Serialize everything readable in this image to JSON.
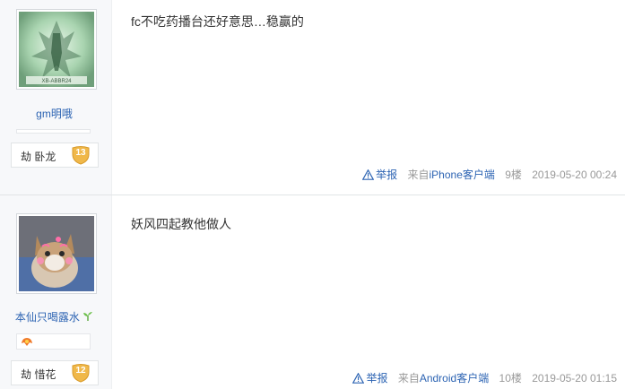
{
  "posts": [
    {
      "username": "gm明哦",
      "avatar_text": "XB-ABBR24",
      "level_name": "劫 卧龙",
      "level_number": "13",
      "content": "fc不吃药播台还好意思…稳赢的",
      "report_label": "举报",
      "source_prefix": "来自",
      "source_client": "iPhone客户端",
      "floor": "9楼",
      "timestamp": "2019-05-20 00:24"
    },
    {
      "username": "本仙只喝露水",
      "level_name": "劫 惜花",
      "level_number": "12",
      "content": "妖风四起教他做人",
      "report_label": "举报",
      "source_prefix": "来自",
      "source_client": "Android客户端",
      "floor": "10楼",
      "timestamp": "2019-05-20 01:15"
    }
  ],
  "colors": {
    "link": "#2d64b3",
    "meta_text": "#999999",
    "badge_gold": "#f0b84a"
  }
}
